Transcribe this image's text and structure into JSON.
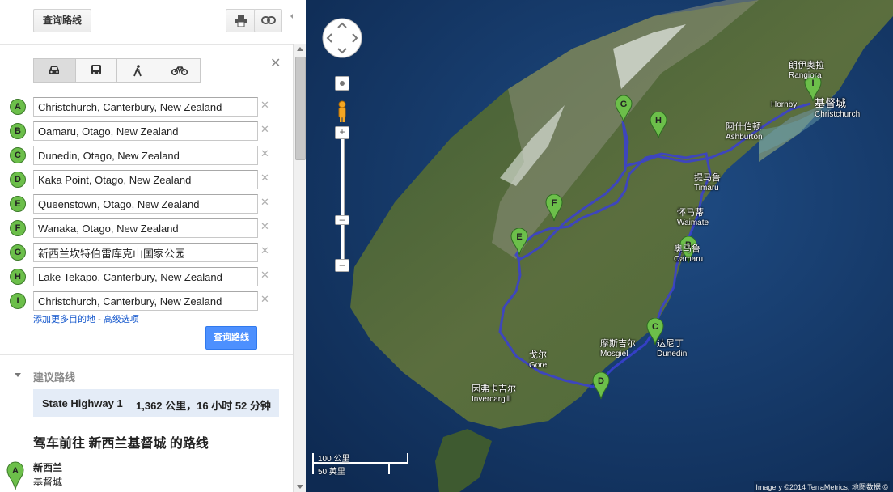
{
  "toolbar": {
    "find_route_label": "查询路线"
  },
  "waypoints": [
    {
      "letter": "A",
      "value": "Christchurch, Canterbury, New Zealand"
    },
    {
      "letter": "B",
      "value": "Oamaru, Otago, New Zealand"
    },
    {
      "letter": "C",
      "value": "Dunedin, Otago, New Zealand"
    },
    {
      "letter": "D",
      "value": "Kaka Point, Otago, New Zealand"
    },
    {
      "letter": "E",
      "value": "Queenstown, Otago, New Zealand"
    },
    {
      "letter": "F",
      "value": "Wanaka, Otago, New Zealand"
    },
    {
      "letter": "G",
      "value": "新西兰坎特伯雷库克山国家公园"
    },
    {
      "letter": "H",
      "value": "Lake Tekapo, Canterbury, New Zealand"
    },
    {
      "letter": "I",
      "value": "Christchurch, Canterbury, New Zealand"
    }
  ],
  "links": {
    "add_destination": "添加更多目的地",
    "separator": "-",
    "advanced": "高级选项"
  },
  "submit_label": "查询路线",
  "suggested": {
    "title": "建议路线",
    "route_name": "State Highway 1",
    "route_summary": "1,362 公里，16 小时 52 分钟"
  },
  "directions": {
    "title": "驾车前往 新西兰基督城 的路线",
    "end_marker": "A",
    "end_name": "新西兰",
    "end_sub": "基督城"
  },
  "map": {
    "labels": {
      "rangiora_cn": "朗伊奥拉",
      "rangiora_en": "Rangiora",
      "christchurch_cn": "基督城",
      "christchurch_en": "Christchurch",
      "hornby": "Hornby",
      "ashburton_cn": "阿什伯顿",
      "ashburton_en": "Ashburton",
      "timaru_cn": "提马鲁",
      "timaru_en": "Timaru",
      "waimate_cn": "怀马蒂",
      "waimate_en": "Waimate",
      "oamaru_cn": "奥马鲁",
      "oamaru_en": "Oamaru",
      "mosgiel_cn": "摩斯吉尔",
      "mosgiel_en": "Mosgiel",
      "dunedin_cn": "达尼丁",
      "dunedin_en": "Dunedin",
      "gore_cn": "戈尔",
      "gore_en": "Gore",
      "invercargill_cn": "因弗卡吉尔",
      "invercargill_en": "Invercargill"
    },
    "pins": [
      "G",
      "H",
      "I",
      "F",
      "E",
      "B",
      "C",
      "D"
    ],
    "scale_km": "100 公里",
    "scale_mi": "50 英里",
    "copyright": "Imagery ©2014 TerraMetrics, 地图数据 ©"
  },
  "colors": {
    "route": "#3a3fd4",
    "pin": "#6cbf4a",
    "button_blue": "#4d90fe",
    "route_box": "#e4ecf7"
  }
}
